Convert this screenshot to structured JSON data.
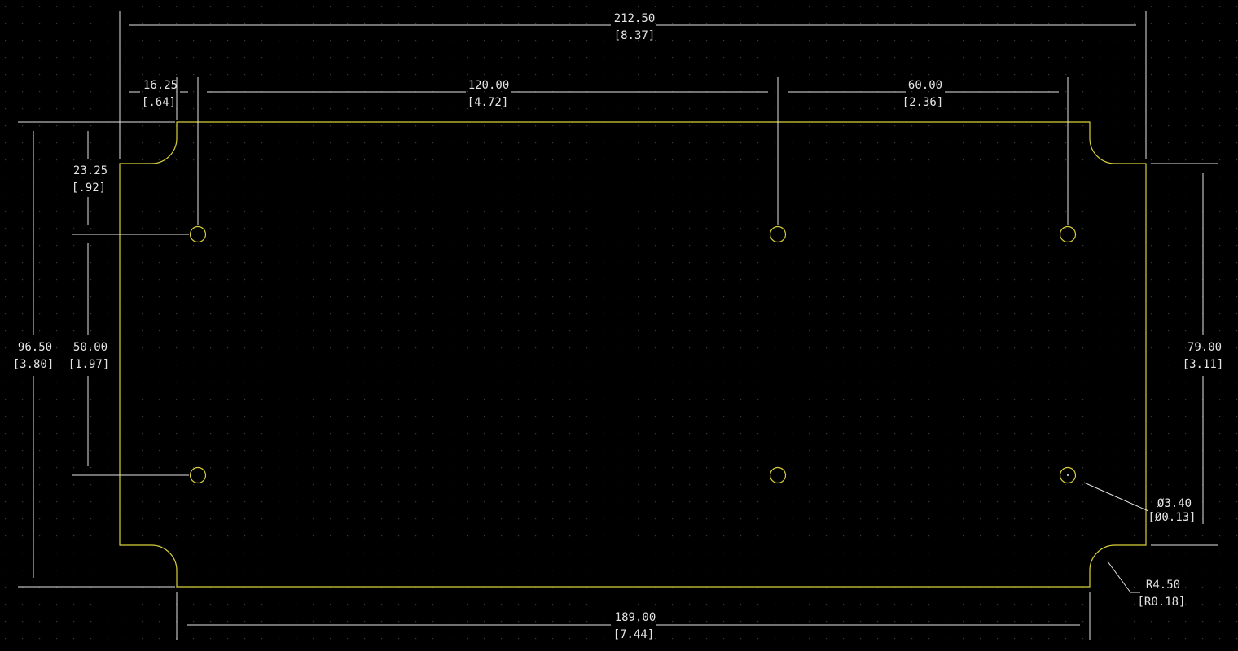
{
  "colors": {
    "background": "#000000",
    "outline": "#d8cf3a",
    "dimension": "#e4e4e4",
    "grid_dot": "#3a3a3a"
  },
  "dimensions": {
    "overall_width": {
      "mm": "212.50",
      "in": "[8.37]"
    },
    "flange_offset": {
      "mm": "16.25",
      "in": "[.64]"
    },
    "hole_span_left": {
      "mm": "120.00",
      "in": "[4.72]"
    },
    "hole_span_right": {
      "mm": "60.00",
      "in": "[2.36]"
    },
    "top_to_hole": {
      "mm": "23.25",
      "in": "[.92]"
    },
    "overall_height": {
      "mm": "96.50",
      "in": "[3.80]"
    },
    "hole_vertical_span": {
      "mm": "50.00",
      "in": "[1.97]"
    },
    "flange_height": {
      "mm": "79.00",
      "in": "[3.11]"
    },
    "hole_diameter": {
      "mm": "Ø3.40",
      "in": "[Ø0.13]"
    },
    "corner_radius": {
      "mm": "R4.50",
      "in": "[R0.18]"
    },
    "inner_width": {
      "mm": "189.00",
      "in": "[7.44]"
    }
  }
}
